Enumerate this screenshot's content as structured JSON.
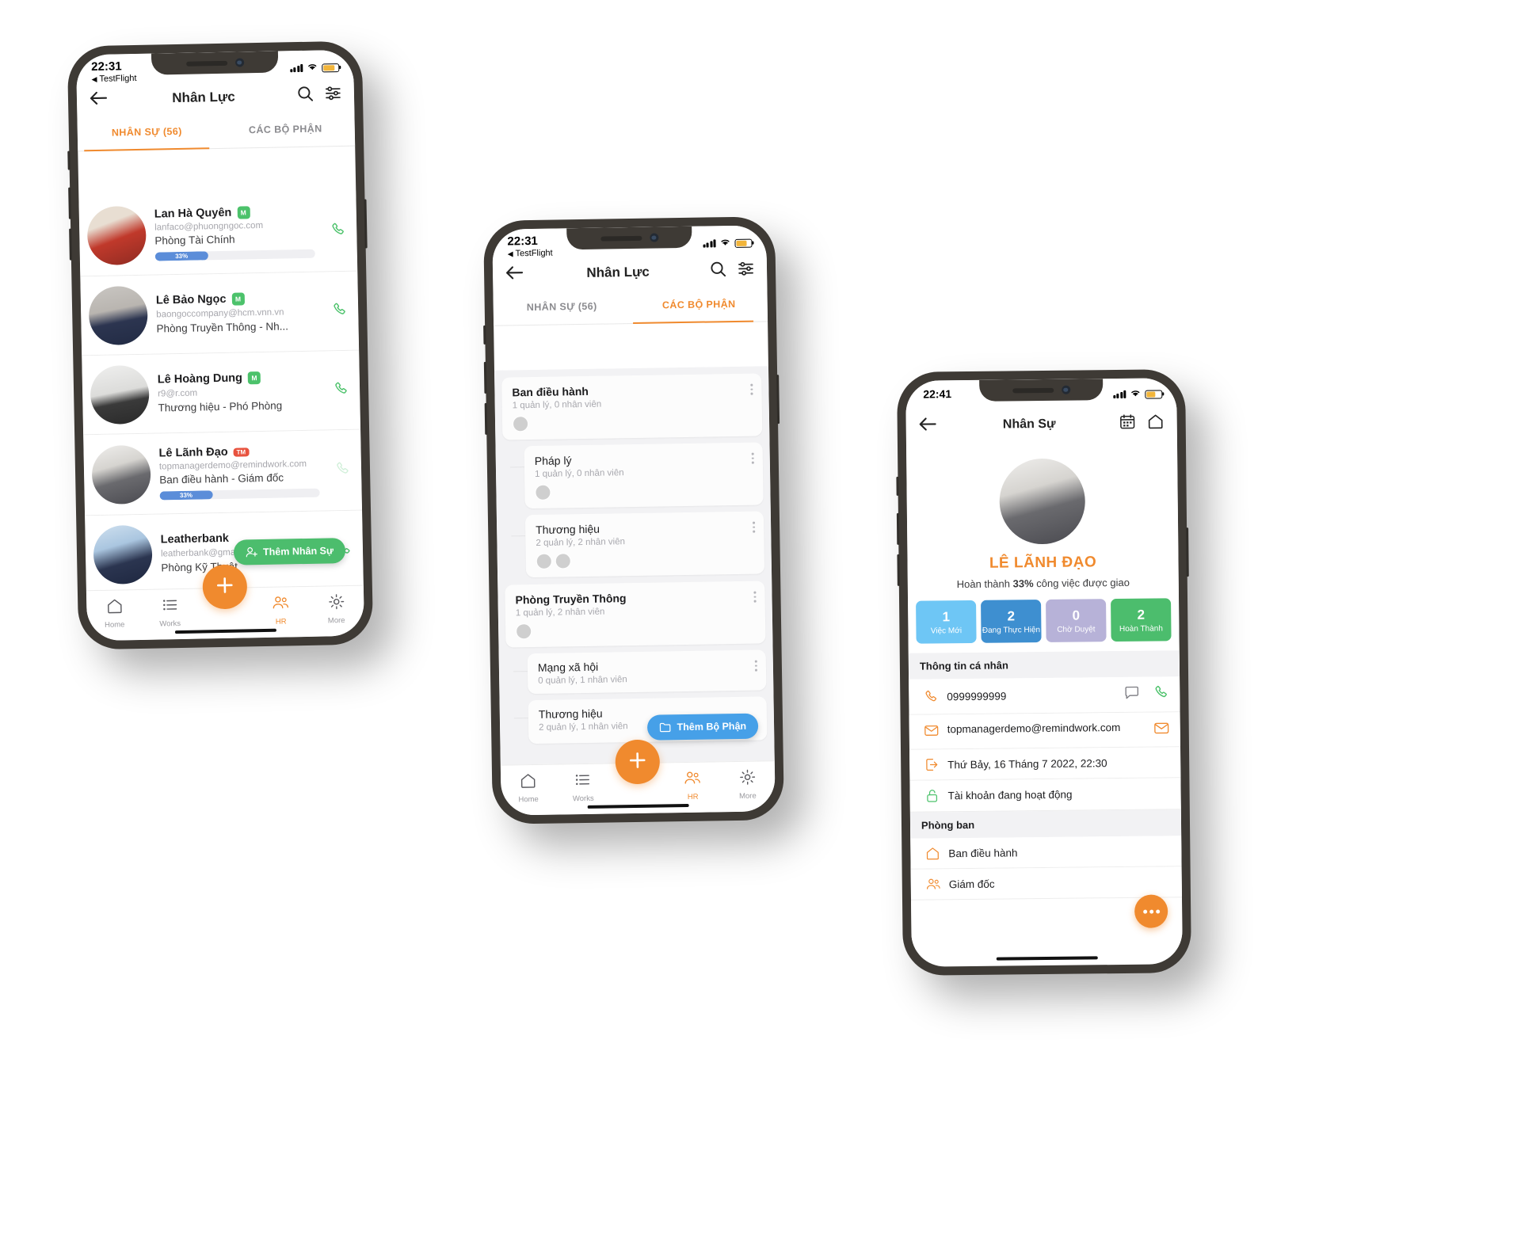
{
  "phone1": {
    "status": {
      "time": "22:31",
      "back_app": "TestFlight"
    },
    "header": {
      "title": "Nhân Lực",
      "back_icon": "back-arrow-icon",
      "search_icon": "search-icon",
      "filter_icon": "filter-icon"
    },
    "tabs": [
      {
        "label": "NHÂN SỰ (56)",
        "active": true
      },
      {
        "label": "CÁC BỘ PHẬN",
        "active": false
      }
    ],
    "people": [
      {
        "name": "Lan Hà Quyên",
        "badge": "M",
        "badge_type": "m",
        "email": "lanfaco@phuongngoc.com",
        "dept": "Phòng Tài Chính",
        "progress": 33,
        "progress_label": "33%",
        "has_progress": true,
        "call": true
      },
      {
        "name": "Lê Bảo Ngọc",
        "badge": "M",
        "badge_type": "m",
        "email": "baongoccompany@hcm.vnn.vn",
        "dept": "Phòng Truyền Thông - Nh...",
        "progress": 0,
        "progress_label": "",
        "has_progress": false,
        "call": true
      },
      {
        "name": "Lê Hoàng Dung",
        "badge": "M",
        "badge_type": "m",
        "email": "r9@r.com",
        "dept": "Thương hiệu - Phó Phòng",
        "progress": 0,
        "progress_label": "",
        "has_progress": false,
        "call": true
      },
      {
        "name": "Lê Lãnh Đạo",
        "badge": "TM",
        "badge_type": "tm",
        "email": "topmanagerdemo@remindwork.com",
        "dept": "Ban điều hành - Giám đốc",
        "progress": 33,
        "progress_label": "33%",
        "has_progress": true,
        "call": true
      },
      {
        "name": "Leatherbank",
        "badge": "",
        "badge_type": "",
        "email": "leatherbank@gmail.com",
        "dept": "Phòng Kỹ Thuật",
        "progress": 0,
        "progress_label": "",
        "has_progress": false,
        "call": true
      }
    ],
    "add_button": {
      "label": "Thêm Nhân Sự",
      "icon": "add-person-icon"
    },
    "nav": [
      {
        "label": "Home",
        "icon": "home-icon",
        "active": false
      },
      {
        "label": "Works",
        "icon": "list-icon",
        "active": false
      },
      {
        "label": "HR",
        "icon": "people-icon",
        "active": true
      },
      {
        "label": "More",
        "icon": "gear-icon",
        "active": false
      }
    ],
    "fab_icon": "plus-icon"
  },
  "phone2": {
    "status": {
      "time": "22:31",
      "back_app": "TestFlight"
    },
    "header": {
      "title": "Nhân Lực",
      "back_icon": "back-arrow-icon",
      "search_icon": "search-icon",
      "filter_icon": "filter-icon"
    },
    "tabs": [
      {
        "label": "NHÂN SỰ (56)",
        "active": false
      },
      {
        "label": "CÁC BỘ PHẬN",
        "active": true
      }
    ],
    "departments": [
      {
        "name": "Ban điều hành",
        "sub": "1 quản lý, 0 nhân viên",
        "avatars": 1,
        "indent": 0
      },
      {
        "name": "Pháp lý",
        "sub": "1 quản lý, 0 nhân viên",
        "avatars": 1,
        "indent": 1
      },
      {
        "name": "Thương hiệu",
        "sub": "2 quản lý, 2 nhân viên",
        "avatars": 2,
        "indent": 1
      },
      {
        "name": "Phòng Truyền Thông",
        "sub": "1 quản lý, 2 nhân viên",
        "avatars": 1,
        "indent": 0
      },
      {
        "name": "Mạng xã hội",
        "sub": "0 quản lý, 1 nhân viên",
        "avatars": 0,
        "indent": 1
      },
      {
        "name": "Thương hiệu",
        "sub": "2 quản lý, 1 nhân viên",
        "avatars": 0,
        "indent": 1
      }
    ],
    "add_button": {
      "label": "Thêm Bộ Phận",
      "icon": "folder-add-icon"
    },
    "nav": [
      {
        "label": "Home",
        "icon": "home-icon",
        "active": false
      },
      {
        "label": "Works",
        "icon": "list-icon",
        "active": false
      },
      {
        "label": "HR",
        "icon": "people-icon",
        "active": true
      },
      {
        "label": "More",
        "icon": "gear-icon",
        "active": false
      }
    ],
    "fab_icon": "plus-icon"
  },
  "phone3": {
    "status": {
      "time": "22:41"
    },
    "header": {
      "title": "Nhân Sự",
      "back_icon": "back-arrow-icon",
      "calendar_icon": "calendar-icon",
      "home_icon": "home-icon"
    },
    "profile": {
      "name": "LÊ LÃNH ĐẠO",
      "summary_prefix": "Hoàn thành ",
      "summary_value": "33%",
      "summary_suffix": " công việc được giao",
      "avatar": "profile-photo"
    },
    "stats": [
      {
        "num": "1",
        "label": "Việc Mới",
        "color": "#6ec6f5"
      },
      {
        "num": "2",
        "label": "Đang Thực Hiện",
        "color": "#3e8fd0"
      },
      {
        "num": "0",
        "label": "Chờ Duyệt",
        "color": "#b7b2d8"
      },
      {
        "num": "2",
        "label": "Hoàn Thành",
        "color": "#4cbd6d"
      }
    ],
    "section_personal": "Thông tin cá nhân",
    "info": [
      {
        "icon": "phone-icon",
        "text": "0999999999",
        "actions": [
          "chat-icon",
          "call-icon"
        ]
      },
      {
        "icon": "mail-icon",
        "text": "topmanagerdemo@remindwork.com",
        "actions": [
          "mail-action-icon"
        ]
      },
      {
        "icon": "login-icon",
        "text": "Thứ Bảy, 16 Tháng 7 2022, 22:30",
        "actions": []
      },
      {
        "icon": "unlock-icon",
        "text": "Tài khoản đang hoạt động",
        "actions": []
      }
    ],
    "section_dept": "Phòng ban",
    "dept_rows": [
      {
        "icon": "home-icon",
        "text": "Ban điều hành"
      },
      {
        "icon": "people-icon",
        "text": "Giám đốc"
      }
    ],
    "more_fab": "more-dots-icon"
  },
  "colors": {
    "accent": "#f08a2e",
    "green": "#4cbd6d",
    "blue": "#46a0e8",
    "progress": "#5b8dd9",
    "badge_m": "#4cc26b",
    "badge_tm": "#e8533f"
  }
}
